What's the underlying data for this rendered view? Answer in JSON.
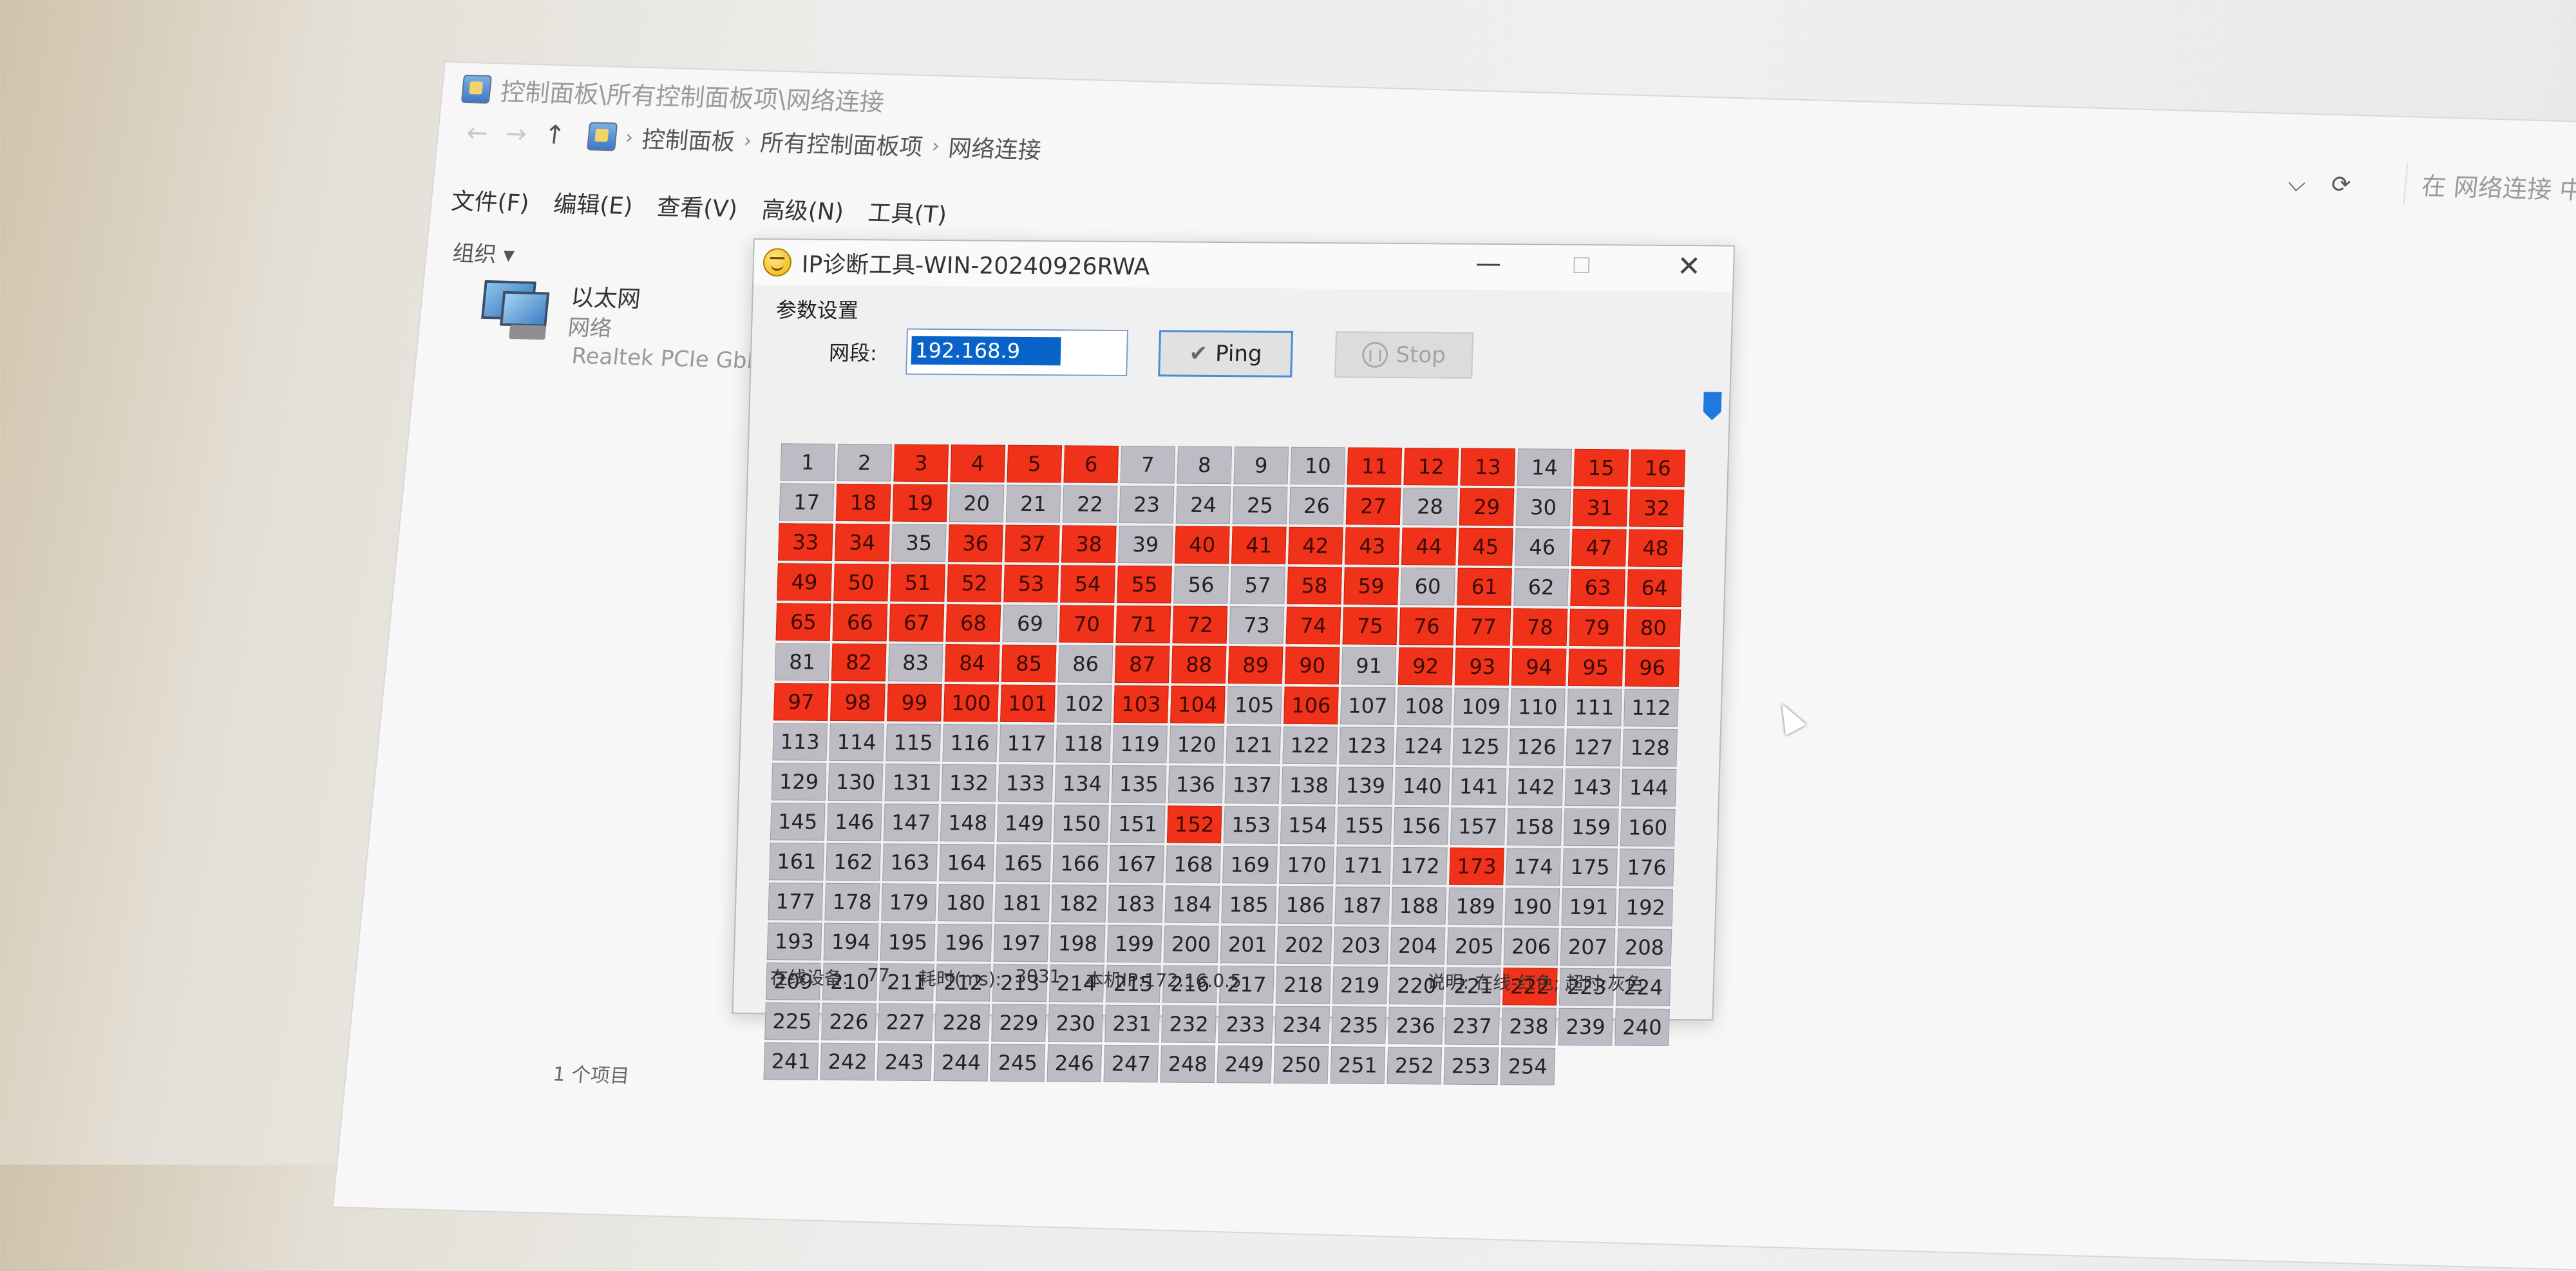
{
  "explorer": {
    "title": "控制面板\\所有控制面板项\\网络连接",
    "nav": {
      "back": "←",
      "forward": "→",
      "up": "↑"
    },
    "breadcrumb": [
      "控制面板",
      "所有控制面板项",
      "网络连接"
    ],
    "refresh": "⟳",
    "dropdown": "⌵",
    "search_placeholder": "在 网络连接 中搜索",
    "menu": [
      "文件(F)",
      "编辑(E)",
      "查看(V)",
      "高级(N)",
      "工具(T)"
    ],
    "organize": "组织 ▾",
    "adapter": {
      "name": "以太网",
      "status": "网络",
      "device": "Realtek PCIe GbE"
    },
    "status_bar": "1 个项目",
    "icons": {
      "view": "view-details-icon"
    }
  },
  "dialog": {
    "title": "IP诊断工具-WIN-20240926RWA",
    "min": "—",
    "max": "☐",
    "close": "✕",
    "params_label": "参数设置",
    "segment_label": "网段:",
    "segment_value": "192.168.9",
    "ping_label": "Ping",
    "stop_label": "Stop",
    "grid_start": 1,
    "grid_end": 254,
    "online": [
      3,
      4,
      5,
      6,
      11,
      12,
      13,
      15,
      16,
      18,
      19,
      27,
      29,
      31,
      32,
      33,
      34,
      36,
      37,
      38,
      40,
      41,
      42,
      43,
      44,
      45,
      47,
      48,
      49,
      50,
      51,
      52,
      53,
      54,
      55,
      58,
      59,
      61,
      63,
      64,
      65,
      66,
      67,
      68,
      70,
      71,
      72,
      74,
      75,
      76,
      77,
      78,
      79,
      80,
      82,
      84,
      85,
      87,
      88,
      89,
      90,
      92,
      93,
      94,
      95,
      96,
      97,
      98,
      99,
      100,
      101,
      103,
      104,
      106,
      152,
      173,
      222
    ],
    "status": {
      "online_label": "在线设备:",
      "online_count": "77",
      "time_label": "耗时(ms):",
      "time_value": "3031",
      "local_ip": "本机IP:172.16.0.5",
      "legend": "说明: 在线-红色; 超时:灰色"
    },
    "colors": {
      "online": "#f0321a",
      "timeout": "#bdbcc4",
      "accent": "#1f7ae0"
    }
  }
}
